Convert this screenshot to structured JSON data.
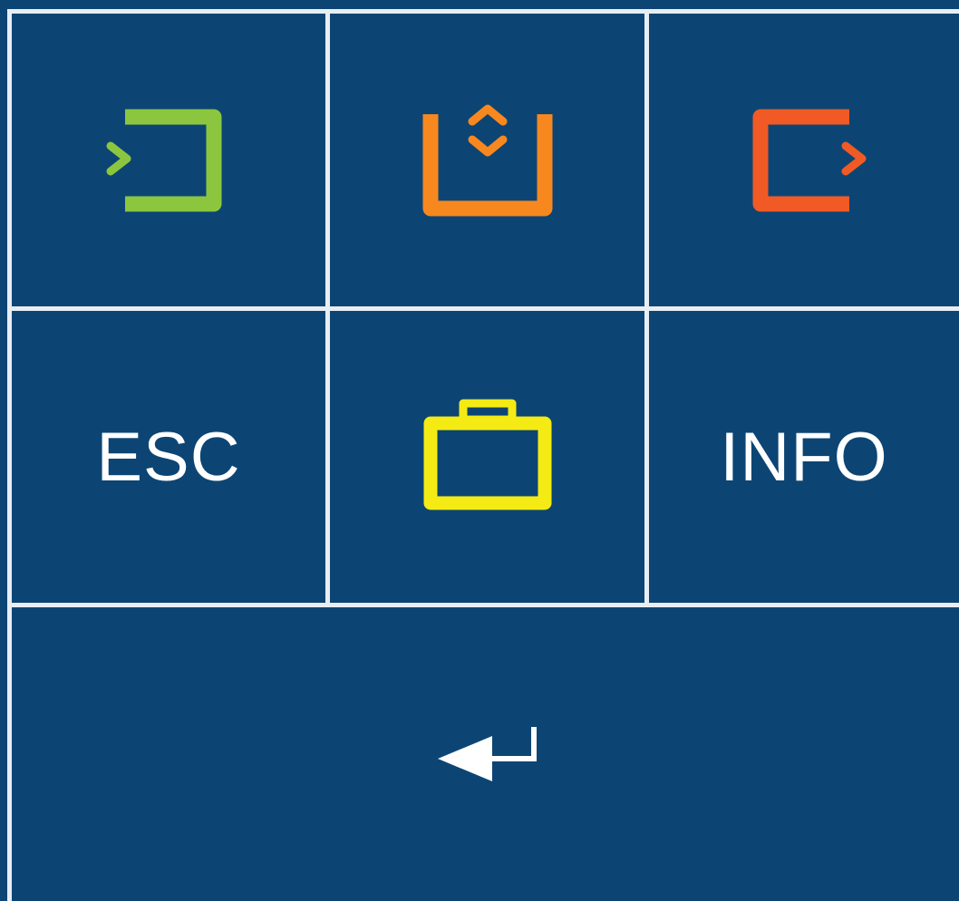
{
  "keypad": {
    "background_color": "#0c4574",
    "grid_line_color": "#e9eef3",
    "row1": [
      {
        "name": "input-key",
        "icon": "input-icon",
        "color": "#8cc63f"
      },
      {
        "name": "menu-key",
        "icon": "menu-updown-icon",
        "color": "#f7881f"
      },
      {
        "name": "output-key",
        "icon": "output-icon",
        "color": "#f15a24"
      }
    ],
    "row2": {
      "esc_label": "ESC",
      "middle_icon": "briefcase-icon",
      "middle_color": "#f5eb14",
      "info_label": "INFO"
    },
    "row3": {
      "icon": "enter-arrow-icon",
      "color": "#ffffff"
    }
  }
}
